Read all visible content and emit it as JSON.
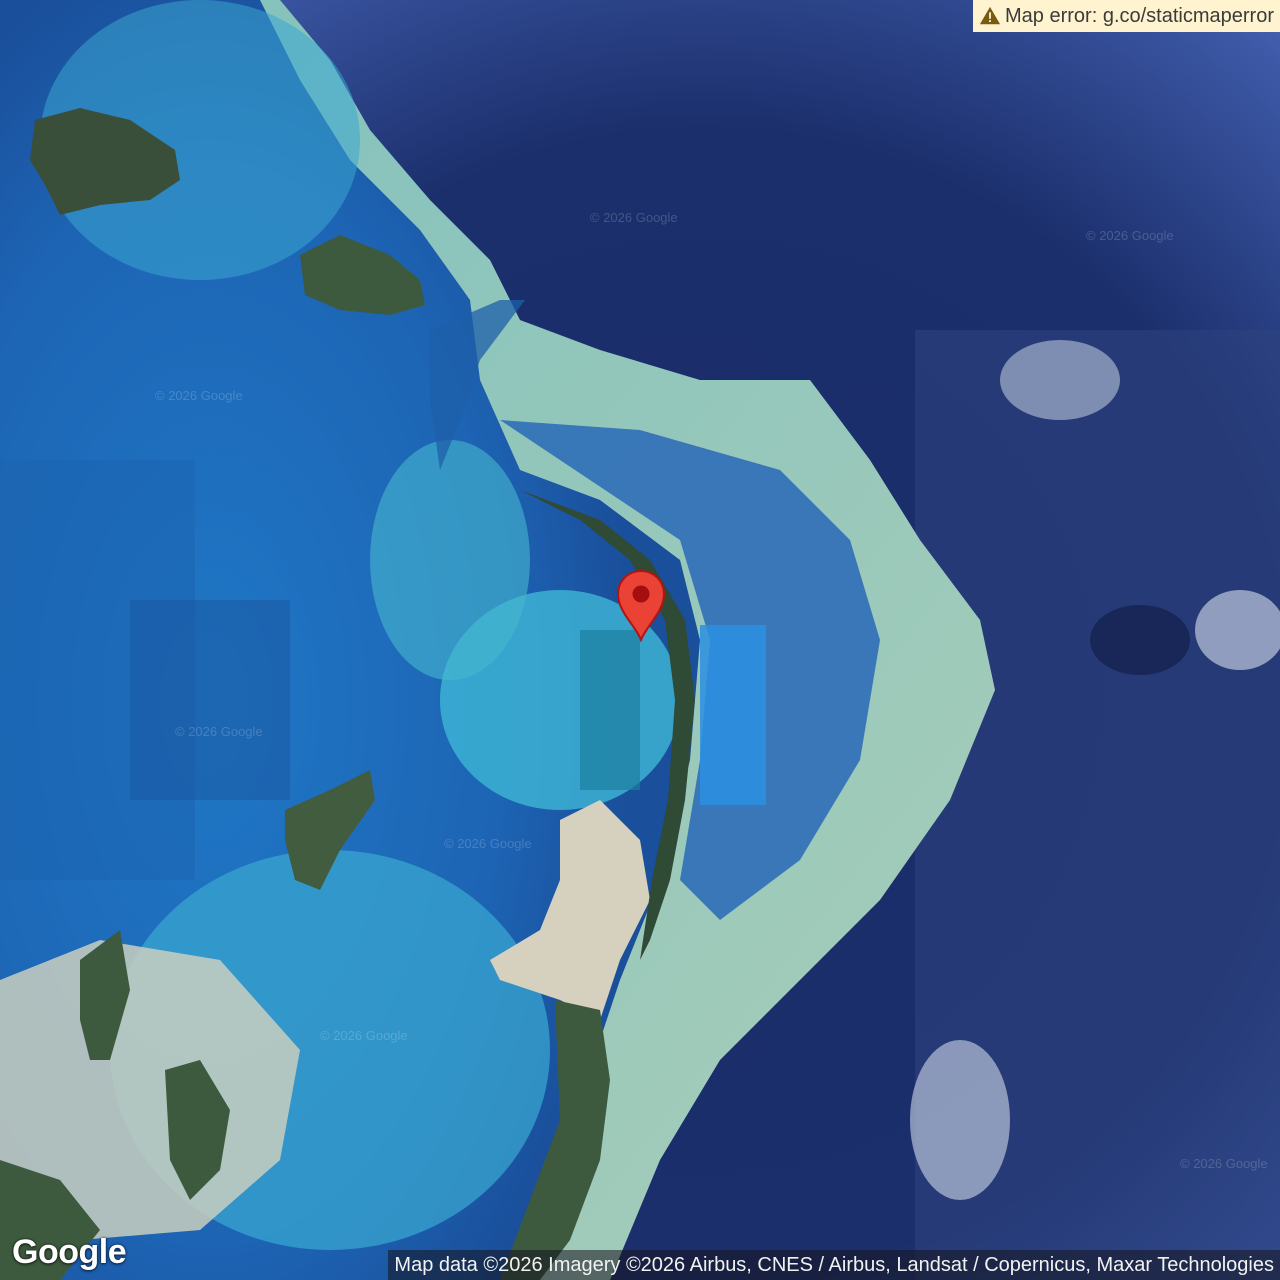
{
  "error_banner": {
    "icon": "warning-icon",
    "text": "Map error: g.co/staticmaperror"
  },
  "logo": {
    "text": "Google"
  },
  "attribution": {
    "text": "Map data ©2026 Imagery ©2026 Airbus, CNES / Airbus, Landsat / Copernicus, Maxar Technologies"
  },
  "watermark": {
    "text": "© 2026 Google"
  },
  "marker": {
    "icon": "map-pin-icon",
    "color": "#ea4335"
  },
  "colors": {
    "deep_ocean": "#16285e",
    "lagoon": "#2a8fd0",
    "reef": "#8fcfc8",
    "sand": "#d8d3c2",
    "vegetation": "#3d5a3e"
  }
}
